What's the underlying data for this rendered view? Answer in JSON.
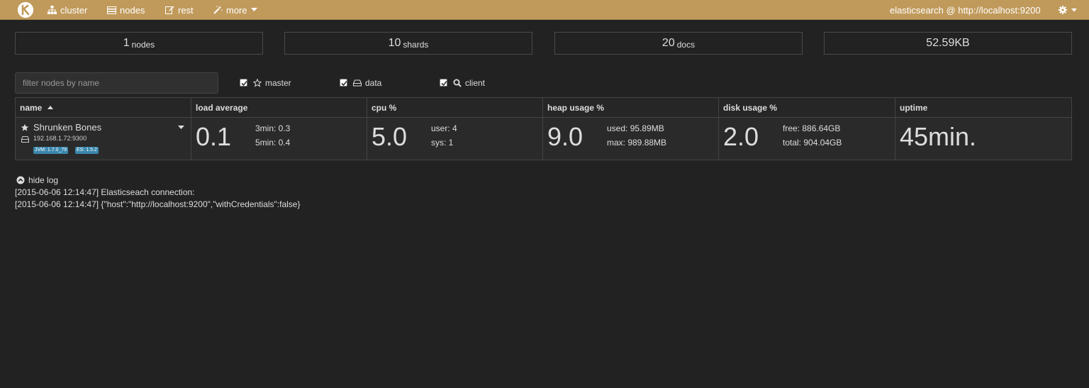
{
  "navbar": {
    "brand_icon": "kopf-logo-icon",
    "items": [
      {
        "label": "cluster",
        "icon": "sitemap-icon"
      },
      {
        "label": "nodes",
        "icon": "server-icon"
      },
      {
        "label": "rest",
        "icon": "edit-icon"
      },
      {
        "label": "more",
        "icon": "magic-wand-icon"
      }
    ],
    "connection": "elasticsearch @ http://localhost:9200",
    "settings_icon": "gear-icon",
    "color": "#c09a5b"
  },
  "stats": {
    "nodes": {
      "num": "1",
      "unit": "nodes"
    },
    "shards": {
      "num": "10",
      "unit": "shards"
    },
    "docs": {
      "num": "20",
      "unit": "docs"
    },
    "size": {
      "num": "52.59KB"
    }
  },
  "filter": {
    "placeholder": "filter nodes by name",
    "value": ""
  },
  "checkboxes": [
    {
      "label": "master",
      "checked": true,
      "icon": "star-outline-icon"
    },
    {
      "label": "data",
      "checked": true,
      "icon": "hdd-icon"
    },
    {
      "label": "client",
      "checked": true,
      "icon": "search-icon"
    }
  ],
  "table": {
    "headers": [
      "name",
      "load average",
      "cpu %",
      "heap usage %",
      "disk usage %",
      "uptime"
    ],
    "sort_indicator": "caret-up-icon",
    "row": {
      "name": "Shrunken Bones",
      "address": "192.168.1.72:9300",
      "badges": [
        "JVM: 1.7.0_79",
        "ES: 1.5.2"
      ],
      "load": {
        "value": "0.1",
        "m3": "3min: 0.3",
        "m5": "5min: 0.4"
      },
      "cpu": {
        "value": "5.0",
        "user": "user: 4",
        "sys": "sys: 1"
      },
      "heap": {
        "value": "9.0",
        "used": "used: 95.89MB",
        "max": "max: 989.88MB"
      },
      "disk": {
        "value": "2.0",
        "free": "free: 886.64GB",
        "total": "total: 904.04GB"
      },
      "uptime": "45min."
    }
  },
  "log": {
    "toggle_label": "hide log",
    "lines": [
      "[2015-06-06 12:14:47] Elasticseach connection:",
      "[2015-06-06 12:14:47] {\"host\":\"http://localhost:9200\",\"withCredentials\":false}"
    ]
  }
}
